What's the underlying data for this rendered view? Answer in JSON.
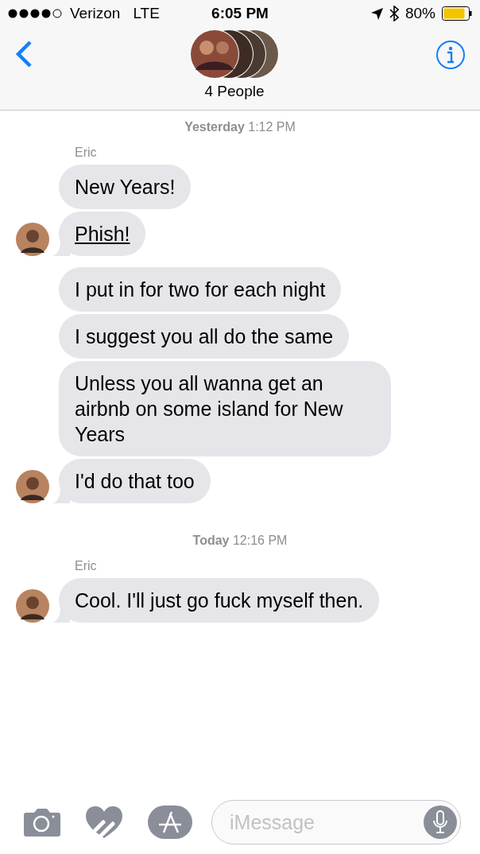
{
  "status_bar": {
    "carrier": "Verizon",
    "network": "LTE",
    "time": "6:05 PM",
    "battery": "80%"
  },
  "nav": {
    "title": "4 People"
  },
  "messages": [
    {
      "kind": "timestamp",
      "text": "**Yesterday** 1:12 PM"
    },
    {
      "kind": "sender",
      "text": "Eric"
    },
    {
      "kind": "bubble",
      "text": "New Years!",
      "avatar": false,
      "link": false
    },
    {
      "kind": "bubble",
      "text": "Phish!",
      "avatar": true,
      "link": true
    },
    {
      "kind": "bubble",
      "text": "I put in for two for each night",
      "avatar": false,
      "link": false
    },
    {
      "kind": "bubble",
      "text": "I suggest you all do the same",
      "avatar": false,
      "link": false
    },
    {
      "kind": "bubble",
      "text": "Unless you all wanna get an airbnb on some island for New Years",
      "avatar": false,
      "link": false
    },
    {
      "kind": "bubble",
      "text": "I'd do that too",
      "avatar": true,
      "link": false
    },
    {
      "kind": "timestamp",
      "text": "**Today** 12:16 PM"
    },
    {
      "kind": "sender",
      "text": "Eric"
    },
    {
      "kind": "bubble",
      "text": "Cool. I'll just go fuck myself then.",
      "avatar": true,
      "link": false
    }
  ],
  "composer": {
    "placeholder": "iMessage"
  }
}
